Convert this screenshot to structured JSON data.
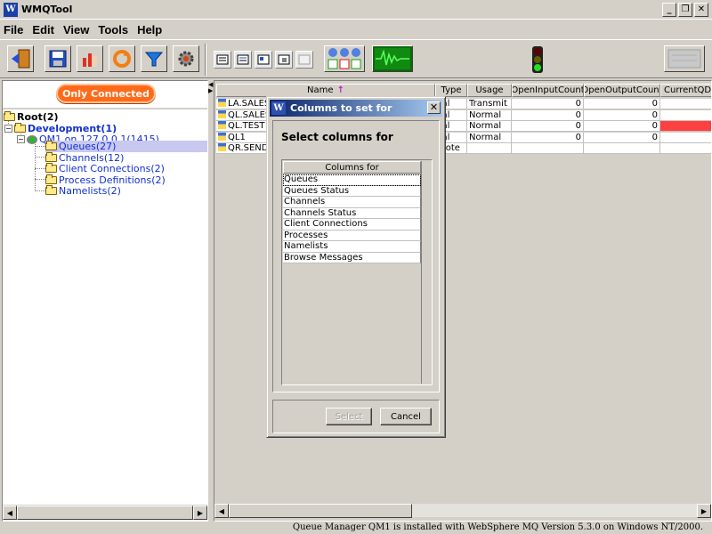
{
  "window": {
    "title": "WMQTool",
    "app_icon": "W"
  },
  "menu": [
    "File",
    "Edit",
    "View",
    "Tools",
    "Help"
  ],
  "left": {
    "only_connected": "Only Connected",
    "tree": {
      "root": "Root(2)",
      "development": "Development(1)",
      "qm": "QM1  on 127.0.0.1(1415)",
      "queues": "Queues(27)",
      "channels": "Channels(12)",
      "client_connections": "Client Connections(2)",
      "process_definitions": "Process Definitions(2)",
      "namelists": "Namelists(2)"
    }
  },
  "table": {
    "headers": [
      "Name",
      "Type",
      "Usage",
      "OpenInputCount",
      "OpenOutputCount",
      "CurrentQDe"
    ],
    "sort_arrow": "↑",
    "rows": [
      {
        "name": "LA.SALES",
        "type": "cal",
        "usage": "Transmit",
        "in": "0",
        "out": "0"
      },
      {
        "name": "QL.SALES",
        "type": "cal",
        "usage": "Normal",
        "in": "0",
        "out": "0"
      },
      {
        "name": "QL.TEST",
        "type": "cal",
        "usage": "Normal",
        "in": "0",
        "out": "0"
      },
      {
        "name": "QL1",
        "type": "cal",
        "usage": "Normal",
        "in": "0",
        "out": "0"
      },
      {
        "name": "QR.SEND.",
        "type": "mote",
        "usage": "",
        "in": "",
        "out": ""
      }
    ],
    "highlight_color": "#ff4040"
  },
  "dialog": {
    "title": "Columns to set for",
    "close": "✕",
    "heading": "Select columns for",
    "list_header": "Columns for",
    "items": [
      "Queues",
      "Queues Status",
      "Channels",
      "Channels Status",
      "Client Connections",
      "Processes",
      "Namelists",
      "Browse Messages"
    ],
    "select_label": "Select",
    "cancel_label": "Cancel"
  },
  "status": "Queue Manager QM1  is installed with WebSphere MQ Version 5.3.0 on Windows NT/2000."
}
